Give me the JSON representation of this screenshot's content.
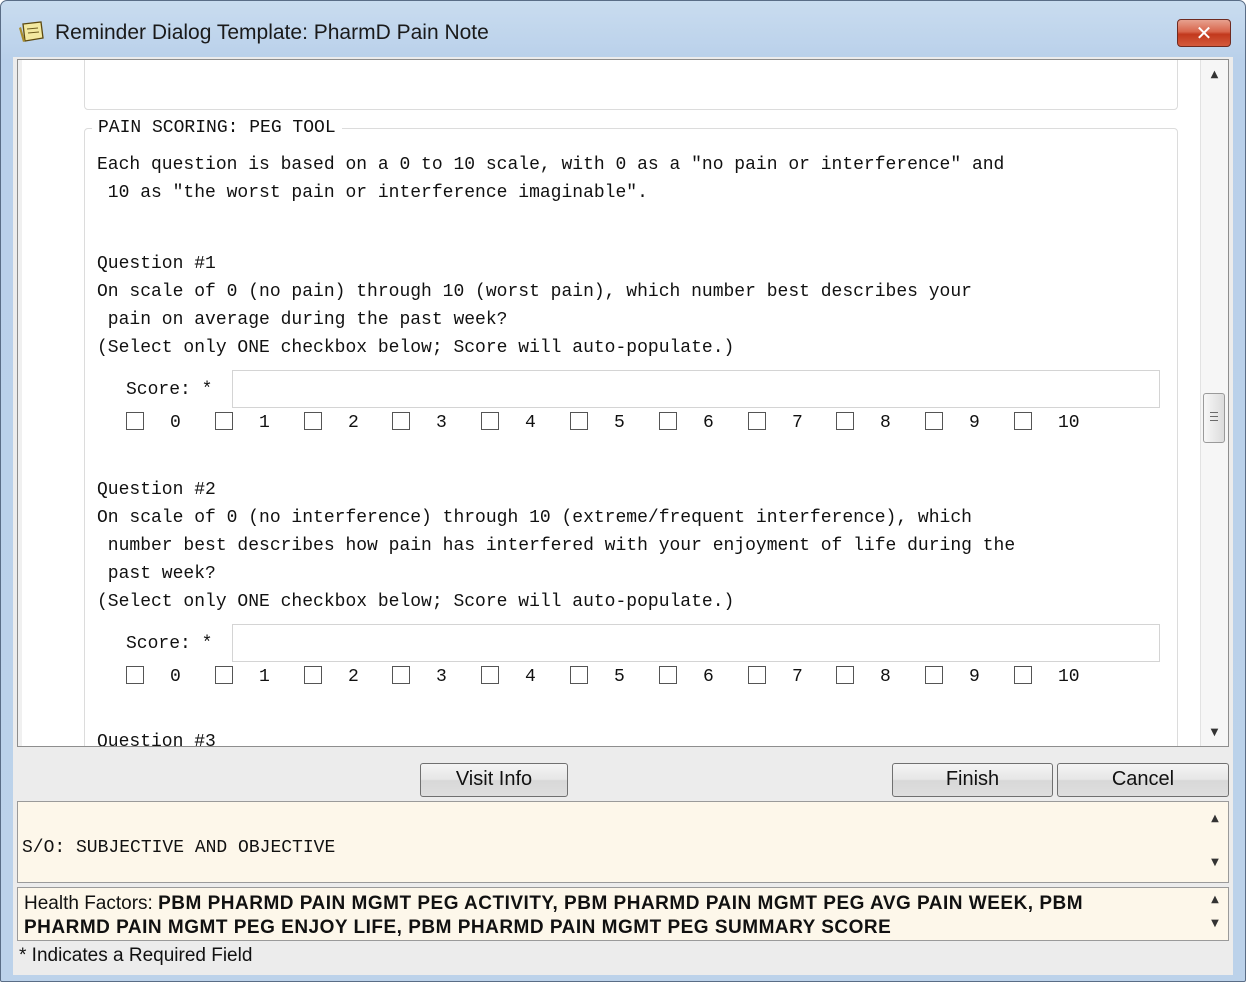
{
  "window": {
    "title": "Reminder Dialog Template: PharmD Pain Note",
    "close_symbol": "✕"
  },
  "icons": {
    "title_icon": "notepad-icon",
    "close_icon": "close-icon",
    "scroll_up": "▲",
    "scroll_down": "▼"
  },
  "section": {
    "legend": "PAIN SCORING: PEG TOOL",
    "intro_line1": "Each question is based on a 0 to 10 scale, with 0 as a \"no pain or interference\" and",
    "intro_line2": " 10 as \"the worst pain or interference imaginable\"."
  },
  "questions": [
    {
      "title": "Question #1",
      "lines": [
        "On scale of 0 (no pain) through 10 (worst pain), which number best describes your",
        " pain on average during the past week?",
        "(Select only ONE checkbox below; Score will auto-populate.)"
      ],
      "score_label": "Score: *",
      "score_value": ""
    },
    {
      "title": "Question #2",
      "lines": [
        "On scale of 0 (no interference) through 10 (extreme/frequent interference), which",
        " number best describes how pain has interfered with your enjoyment of life during the",
        " past week?",
        "(Select only ONE checkbox below; Score will auto-populate.)"
      ],
      "score_label": "Score: *",
      "score_value": ""
    },
    {
      "title": "Question #3"
    }
  ],
  "checkbox_options": [
    "0",
    "1",
    "2",
    "3",
    "4",
    "5",
    "6",
    "7",
    "8",
    "9",
    "10"
  ],
  "buttons": {
    "visit_info": "Visit Info",
    "finish": "Finish",
    "cancel": "Cancel"
  },
  "preview": {
    "text": "S/O: SUBJECTIVE AND OBJECTIVE"
  },
  "health_factors": {
    "label": "Health Factors:",
    "items_line1": "PBM PHARMD PAIN MGMT PEG ACTIVITY, PBM PHARMD PAIN MGMT PEG AVG PAIN WEEK, PBM",
    "items_line2": "PHARMD PAIN MGMT PEG ENJOY LIFE, PBM PHARMD PAIN MGMT PEG SUMMARY SCORE"
  },
  "footer": {
    "required_note": "* Indicates a Required Field"
  },
  "colors": {
    "title_gradient": "#bcd2ea",
    "close_button": "#c2391d",
    "panel_bg": "#fdf7ea"
  }
}
